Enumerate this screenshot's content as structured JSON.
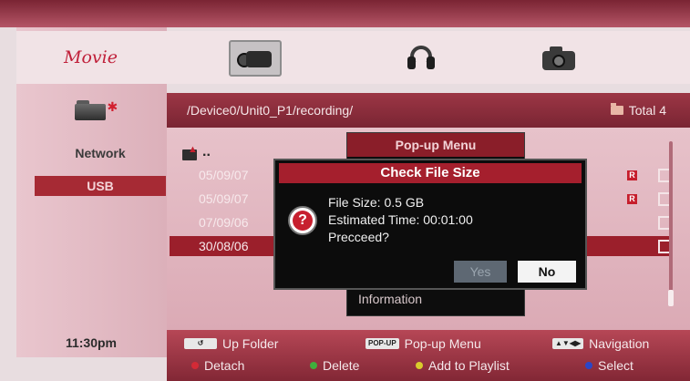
{
  "window": {
    "section_title": "Movie"
  },
  "media_tabs": [
    {
      "name": "movie-tab",
      "icon": "camcorder-icon",
      "selected": true
    },
    {
      "name": "music-tab",
      "icon": "headphones-icon",
      "selected": false
    },
    {
      "name": "photo-tab",
      "icon": "camera-icon",
      "selected": false
    }
  ],
  "sidebar": {
    "items": [
      {
        "label": "Network",
        "selected": false
      },
      {
        "label": "USB",
        "selected": true
      }
    ],
    "clock": "11:30pm"
  },
  "pathbar": {
    "path": "/Device0/Unit0_P1/recording/",
    "total": "Total 4"
  },
  "filelist": {
    "up_label": "..",
    "rows": [
      {
        "date": "05/09/07",
        "badge": "R",
        "selected": false
      },
      {
        "date": "05/09/07",
        "badge": "R",
        "selected": false
      },
      {
        "date": "07/09/06",
        "badge": "",
        "selected": false
      },
      {
        "date": "30/08/06",
        "badge": "",
        "selected": true
      }
    ]
  },
  "popup_menu": {
    "title": "Pop-up Menu",
    "info_item": "Information"
  },
  "dialog": {
    "title": "Check File Size",
    "line1": "File Size: 0.5 GB",
    "line2": "Estimated Time: 00:01:00",
    "line3": "Precceed?",
    "yes": "Yes",
    "no": "No",
    "focused": "No"
  },
  "legend": {
    "up_folder_key": "",
    "up_folder": "Up Folder",
    "popup_key": "POP-UP",
    "popup": "Pop-up Menu",
    "nav_key": "▲▼◀▶",
    "navigation": "Navigation",
    "detach": "Detach",
    "delete": "Delete",
    "add_to_playlist": "Add to Playlist",
    "select": "Select"
  },
  "colors": {
    "accent_red": "#a51f2d",
    "red": "#d42a36",
    "green": "#3fae3c",
    "yellow": "#d9cc2c",
    "blue": "#2a46c8"
  }
}
